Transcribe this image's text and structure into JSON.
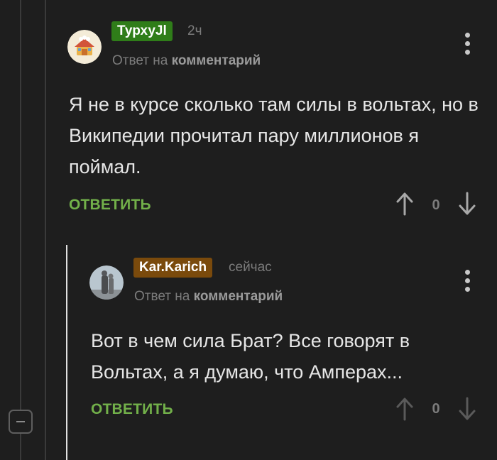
{
  "comments": [
    {
      "username": "ТурхуJl",
      "username_bg": "#2f7d19",
      "timestamp": "2ч",
      "reply_prefix": "Ответ на",
      "reply_target": "комментарий",
      "body": "Я не в курсе сколько там силы в вольтах, но в Википедии прочитал пару миллионов я поймал.",
      "reply_label": "ОТВЕТИТЬ",
      "rating": "0"
    },
    {
      "username": "Kar.Karich",
      "username_bg": "#7a4a0c",
      "timestamp": "сейчас",
      "reply_prefix": "Ответ на",
      "reply_target": "комментарий",
      "body": "Вот в чем сила Брат? Все говорят в Вольтах, а я думаю, что Амперах...",
      "reply_label": "ОТВЕТИТЬ",
      "rating": "0"
    }
  ],
  "icons": {
    "upvote": "arrow-up-icon",
    "downvote": "arrow-down-icon",
    "menu": "kebab-menu-icon",
    "collapse": "minus-icon"
  },
  "colors": {
    "background": "#1e1e1e",
    "accent_reply": "#72b04a",
    "muted_text": "#7c7c7c"
  }
}
